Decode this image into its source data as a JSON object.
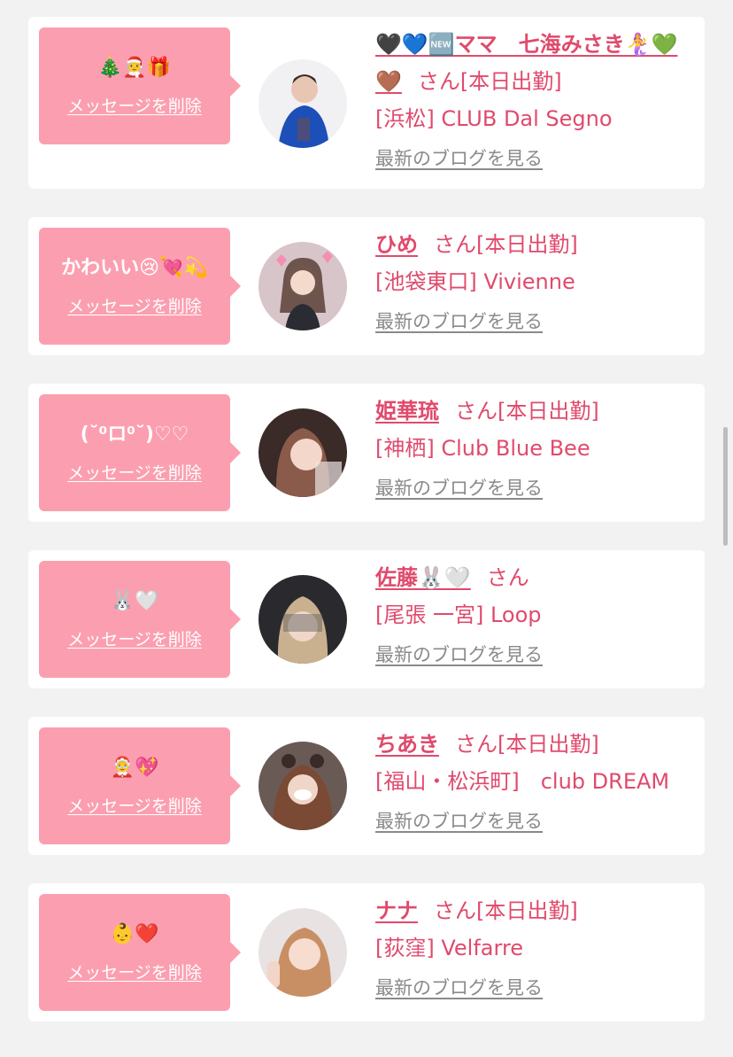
{
  "cards": [
    {
      "message": "🎄🧑‍🎄🎁",
      "delete_label": "メッセージを削除",
      "name": "🖤💙🆕ママ　七海みさき🧜‍♀️💚🤎",
      "san_label": "さん[本日出勤]",
      "shop": "[浜松] CLUB Dal Segno",
      "blog_label": "最新のブログを見る"
    },
    {
      "message": "かわいい😢💘💫",
      "delete_label": "メッセージを削除",
      "name": "ひめ",
      "san_label": "さん[本日出勤]",
      "shop": "[池袋東口] Vivienne",
      "blog_label": "最新のブログを見る"
    },
    {
      "message": "(˘⁰ロ⁰˘)♡♡",
      "delete_label": "メッセージを削除",
      "name": "姫華琉",
      "san_label": "さん[本日出勤]",
      "shop": "[神栖] Club Blue Bee",
      "blog_label": "最新のブログを見る"
    },
    {
      "message": "🐰🤍",
      "delete_label": "メッセージを削除",
      "name": "佐藤🐰🤍",
      "san_label": "さん",
      "shop": "[尾張 一宮] Loop",
      "blog_label": "最新のブログを見る"
    },
    {
      "message": "🤶💖",
      "delete_label": "メッセージを削除",
      "name": "ちあき",
      "san_label": "さん[本日出勤]",
      "shop": "[福山・松浜町]　club DREAM",
      "blog_label": "最新のブログを見る"
    },
    {
      "message": "👶❤️",
      "delete_label": "メッセージを削除",
      "name": "ナナ",
      "san_label": "さん[本日出勤]",
      "shop": "[荻窪] Velfarre",
      "blog_label": "最新のブログを見る"
    }
  ],
  "colors": {
    "accent": "#e04a6c",
    "bubble": "#fb9fb0",
    "link_gray": "#8a8a8a",
    "background": "#f2f2f2"
  }
}
